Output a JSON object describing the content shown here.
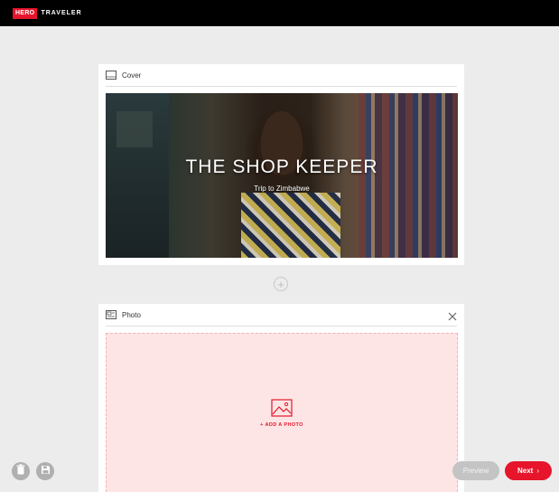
{
  "brand": {
    "hero": "HERO",
    "traveler": "TRAVELER",
    "accent": "#e6152b"
  },
  "cover_section": {
    "label": "Cover",
    "icon": "cover-image-icon",
    "title": "THE SHOP KEEPER",
    "subtitle": "Trip to Zimbabwe"
  },
  "add_section": {
    "icon": "plus-icon",
    "label": "+"
  },
  "photo_section": {
    "label": "Photo",
    "icon": "photo-icon",
    "add_photo_label": "+ ADD A PHOTO",
    "close_icon": "close-icon"
  },
  "footer": {
    "delete_icon": "trash-icon",
    "save_icon": "save-icon",
    "preview_label": "Preview",
    "next_label": "Next",
    "next_chevron": "›"
  }
}
